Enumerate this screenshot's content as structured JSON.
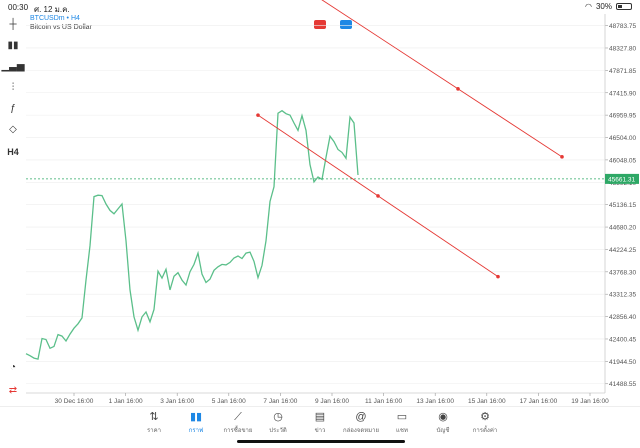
{
  "status": {
    "time": "00:30",
    "date": "ศ. 12 ม.ค.",
    "battery": "30%",
    "battery_level": 0.3
  },
  "symbol": {
    "name": "BTCUSDm • H4",
    "description": "Bitcoin vs US Dollar"
  },
  "toolbar": [
    {
      "icon": "crosshair-icon",
      "glyph": "┼"
    },
    {
      "icon": "candles-icon",
      "glyph": "▮▮"
    },
    {
      "icon": "bar-chart-icon",
      "glyph": "▁▃▅"
    },
    {
      "icon": "indicators-icon",
      "glyph": "⫶"
    },
    {
      "icon": "function-icon",
      "glyph": "ƒ"
    },
    {
      "icon": "shapes-icon",
      "glyph": "◇"
    },
    {
      "icon": "timeframe-label",
      "glyph": "H4"
    }
  ],
  "colors": {
    "line": "#5bbf8a",
    "trendline": "#e53935",
    "price_tag": "#2ea866",
    "accent": "#1e88e5",
    "grid": "#eeeeee"
  },
  "current_price": "45661.31",
  "chart_data": {
    "type": "line",
    "ylim": [
      41300,
      49020
    ],
    "y_ticks": [
      "48783.75",
      "48327.80",
      "47871.85",
      "47415.90",
      "46959.95",
      "46504.00",
      "46048.05",
      "45592.10",
      "45136.15",
      "44680.20",
      "44224.25",
      "43768.30",
      "43312.35",
      "42856.40",
      "42400.45",
      "41944.50",
      "41488.55"
    ],
    "x_ticks": [
      "30 Dec 16:00",
      "1 Jan 16:00",
      "3 Jan 16:00",
      "5 Jan 16:00",
      "7 Jan 16:00",
      "9 Jan 16:00",
      "11 Jan 16:00",
      "13 Jan 16:00",
      "15 Jan 16:00",
      "17 Jan 16:00",
      "19 Jan 16:00"
    ],
    "series": [
      {
        "values": [
          42100,
          42060,
          42010,
          41990,
          42410,
          42390,
          42210,
          42250,
          42490,
          42460,
          42360,
          42500,
          42620,
          42710,
          42830,
          43600,
          44300,
          45300,
          45330,
          45320,
          45150,
          45020,
          44950,
          45050,
          45150,
          44400,
          43400,
          42850,
          42580,
          42850,
          42950,
          42750,
          43000,
          43780,
          43640,
          43820,
          43400,
          43680,
          43750,
          43600,
          43500,
          43770,
          43920,
          44150,
          43720,
          43550,
          43620,
          43800,
          43870,
          43920,
          43910,
          43960,
          44050,
          44090,
          44040,
          44150,
          44170,
          43980,
          43650,
          43900,
          44400,
          45200,
          45500,
          47000,
          47050,
          46990,
          46960,
          46800,
          46650,
          46950,
          46650,
          45950,
          45600,
          45700,
          45650,
          46100,
          46530,
          46420,
          46260,
          46200,
          46080,
          46920,
          46800,
          45740
        ]
      }
    ],
    "trendlines": [
      {
        "start": [
          61,
          50000
        ],
        "end": [
          134,
          46110
        ],
        "dot": 108
      },
      {
        "start": [
          58,
          46960
        ],
        "end": [
          118,
          43670
        ],
        "dot": 88
      }
    ]
  },
  "tabs": [
    {
      "icon": "quotes-icon",
      "glyph": "⇅",
      "label": "ราคา"
    },
    {
      "icon": "chart-icon",
      "glyph": "▮▮",
      "label": "กราฟ",
      "active": true
    },
    {
      "icon": "trade-icon",
      "glyph": "⟋",
      "label": "การซื้อขาย"
    },
    {
      "icon": "history-icon",
      "glyph": "◷",
      "label": "ประวัติ"
    },
    {
      "icon": "news-icon",
      "glyph": "▤",
      "label": "ข่าว"
    },
    {
      "icon": "mailbox-icon",
      "glyph": "@",
      "label": "กล่องจดหมาย"
    },
    {
      "icon": "chat-icon",
      "glyph": "▭",
      "label": "แชท"
    },
    {
      "icon": "account-icon",
      "glyph": "◉",
      "label": "บัญชี"
    },
    {
      "icon": "settings-icon",
      "glyph": "⚙",
      "label": "การตั้งค่า"
    }
  ]
}
